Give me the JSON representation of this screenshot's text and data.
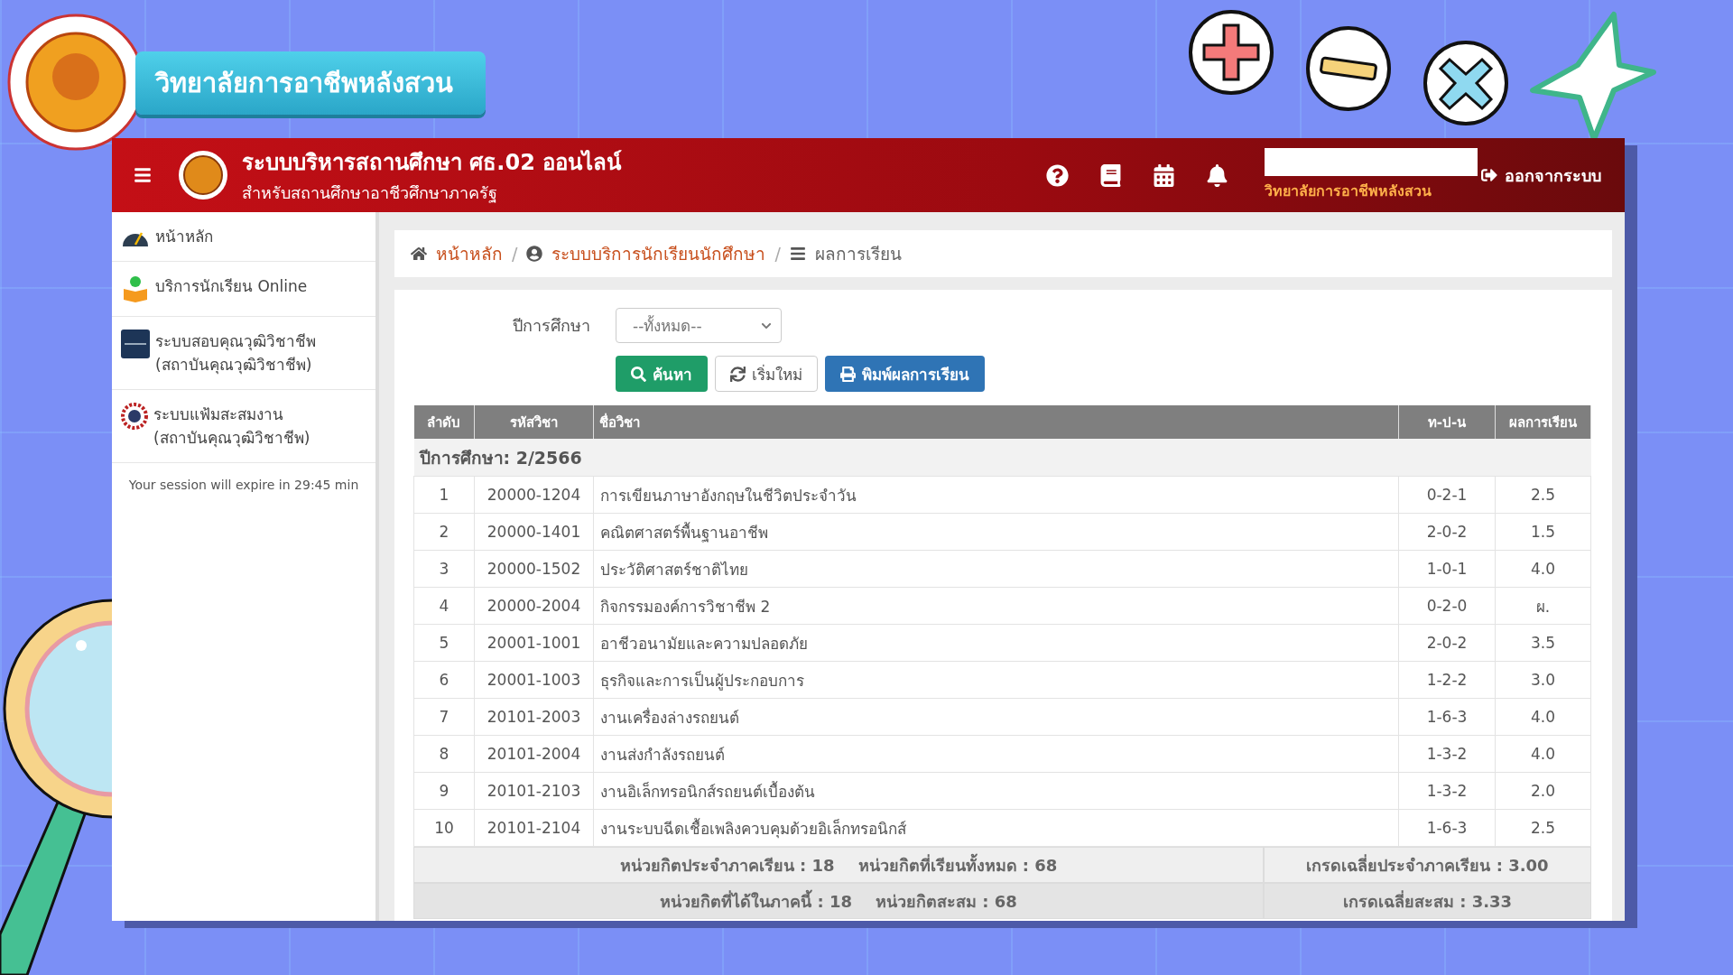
{
  "banner": {
    "title": "วิทยาลัยการอาชีพหลังสวน"
  },
  "header": {
    "title": "ระบบบริหารสถานศึกษา ศธ.02 ออนไลน์",
    "subtitle": "สำหรับสถานศึกษาอาชีวศึกษาภาครัฐ",
    "college": "วิทยาลัยการอาชีพหลังสวน",
    "logout": "ออกจากระบบ"
  },
  "sidebar": {
    "items": [
      {
        "label": "หน้าหลัก",
        "kind": "gauge"
      },
      {
        "label": "บริการนักเรียน Online",
        "kind": "student"
      },
      {
        "label": "ระบบสอบคุณวุฒิวิชาชีพ",
        "sublabel": "(สถาบันคุณวุฒิวิชาชีพ)",
        "kind": "square"
      },
      {
        "label": "ระบบแฟ้มสะสมงาน",
        "sublabel": "(สถาบันคุณวุฒิวิชาชีพ)",
        "kind": "emblem"
      }
    ],
    "session": "Your session will expire in 29:45 min"
  },
  "breadcrumb": [
    {
      "label": "หน้าหลัก",
      "kind": "home",
      "separator": "/"
    },
    {
      "label": "ระบบบริการนักเรียนนักศึกษา",
      "kind": "user",
      "separator": "/"
    },
    {
      "label": "ผลการเรียน",
      "kind": "current"
    }
  ],
  "filter": {
    "label": "ปีการศึกษา",
    "value": "--ทั้งหมด--"
  },
  "buttons": [
    {
      "label": "ค้นหา",
      "kind": "search"
    },
    {
      "label": "เริ่มใหม่",
      "kind": "reset"
    },
    {
      "label": "พิมพ์ผลการเรียน",
      "kind": "print"
    }
  ],
  "table": {
    "columns": [
      "ลำดับ",
      "รหัสวิชา",
      "ชื่อวิชา",
      "ท-ป-น",
      "ผลการเรียน"
    ],
    "group": "ปีการศึกษา: 2/2566",
    "rows": [
      [
        "1",
        "20000-1204",
        "การเขียนภาษาอังกฤษในชีวิตประจำวัน",
        "0-2-1",
        "2.5"
      ],
      [
        "2",
        "20000-1401",
        "คณิตศาสตร์พื้นฐานอาชีพ",
        "2-0-2",
        "1.5"
      ],
      [
        "3",
        "20000-1502",
        "ประวัติศาสตร์ชาติไทย",
        "1-0-1",
        "4.0"
      ],
      [
        "4",
        "20000-2004",
        "กิจกรรมองค์การวิชาชีพ 2",
        "0-2-0",
        "ผ."
      ],
      [
        "5",
        "20001-1001",
        "อาชีวอนามัยและความปลอดภัย",
        "2-0-2",
        "3.5"
      ],
      [
        "6",
        "20001-1003",
        "ธุรกิจและการเป็นผู้ประกอบการ",
        "1-2-2",
        "3.0"
      ],
      [
        "7",
        "20101-2003",
        "งานเครื่องล่างรถยนต์",
        "1-6-3",
        "4.0"
      ],
      [
        "8",
        "20101-2004",
        "งานส่งกำลังรถยนต์",
        "1-3-2",
        "4.0"
      ],
      [
        "9",
        "20101-2103",
        "งานอิเล็กทรอนิกส์รถยนต์เบื้องต้น",
        "1-3-2",
        "2.0"
      ],
      [
        "10",
        "20101-2104",
        "งานระบบฉีดเชื้อเพลิงควบคุมด้วยอิเล็กทรอนิกส์",
        "1-6-3",
        "2.5"
      ]
    ],
    "summary": [
      {
        "credits": [
          "หน่วยกิตประจำภาคเรียน : 18",
          "หน่วยกิตที่เรียนทั้งหมด : 68"
        ],
        "gpa": "เกรดเฉลี่ยประจำภาคเรียน : 3.00"
      },
      {
        "credits": [
          "หน่วยกิตที่ได้ในภาคนี้ : 18",
          "หน่วยกิตสะสม : 68"
        ],
        "gpa": "เกรดเฉลี่ยสะสม : 3.33"
      }
    ]
  }
}
